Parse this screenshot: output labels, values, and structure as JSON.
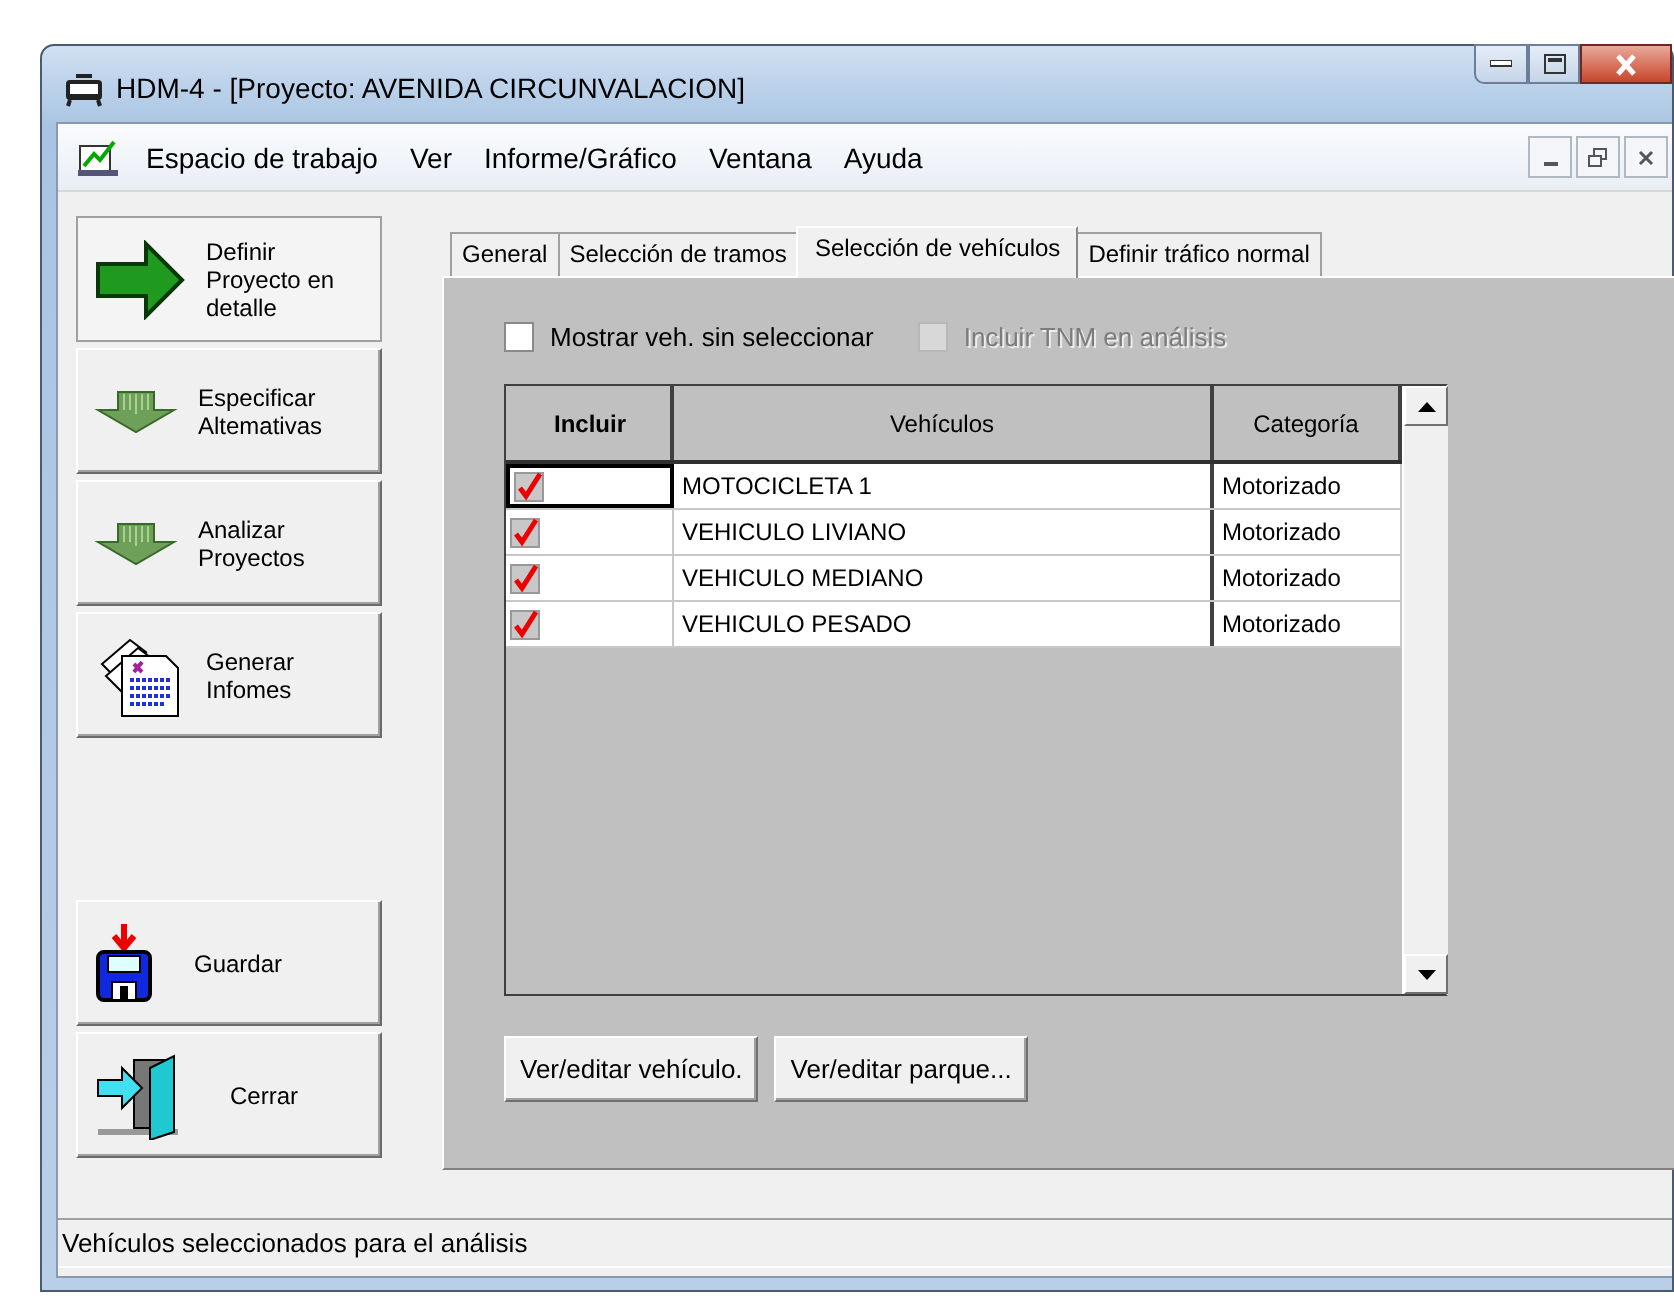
{
  "window": {
    "title": "HDM-4 - [Proyecto: AVENIDA CIRCUNVALACION]"
  },
  "menu": [
    "Espacio de trabajo",
    "Ver",
    "Informe/Gráfico",
    "Ventana",
    "Ayuda"
  ],
  "sidebar": {
    "items": [
      {
        "label": "Definir Proyecto en detalle",
        "kind": "arrow-right",
        "selected": true
      },
      {
        "label": "Especificar Altemativas",
        "kind": "arrow-down",
        "selected": false
      },
      {
        "label": "Analizar Proyectos",
        "kind": "arrow-down",
        "selected": false
      },
      {
        "label": "Generar Infomes",
        "kind": "reports",
        "selected": false
      }
    ],
    "actions": [
      {
        "label": "Guardar",
        "kind": "save"
      },
      {
        "label": "Cerrar",
        "kind": "exit"
      }
    ]
  },
  "tabs": [
    {
      "label": "General",
      "selected": false
    },
    {
      "label": "Selección de tramos",
      "selected": false
    },
    {
      "label": "Selección de vehículos",
      "selected": true
    },
    {
      "label": "Definir tráfico normal",
      "selected": false
    }
  ],
  "options": [
    {
      "label": "Mostrar veh. sin seleccionar",
      "checked": false,
      "disabled": false
    },
    {
      "label": "Incluir TNM en análisis",
      "checked": false,
      "disabled": true
    }
  ],
  "table": {
    "columns": [
      "Incluir",
      "Vehículos",
      "Categoría"
    ],
    "rows": [
      {
        "checked": true,
        "selected": true,
        "vehicle": "MOTOCICLETA 1",
        "category": "Motorizado"
      },
      {
        "checked": true,
        "selected": false,
        "vehicle": "VEHICULO LIVIANO",
        "category": "Motorizado"
      },
      {
        "checked": true,
        "selected": false,
        "vehicle": "VEHICULO MEDIANO",
        "category": "Motorizado"
      },
      {
        "checked": true,
        "selected": false,
        "vehicle": "VEHICULO PESADO",
        "category": "Motorizado"
      }
    ]
  },
  "buttons": [
    "Ver/editar vehículo.",
    "Ver/editar parque..."
  ],
  "status_bar": "Vehículos seleccionados para el análisis"
}
